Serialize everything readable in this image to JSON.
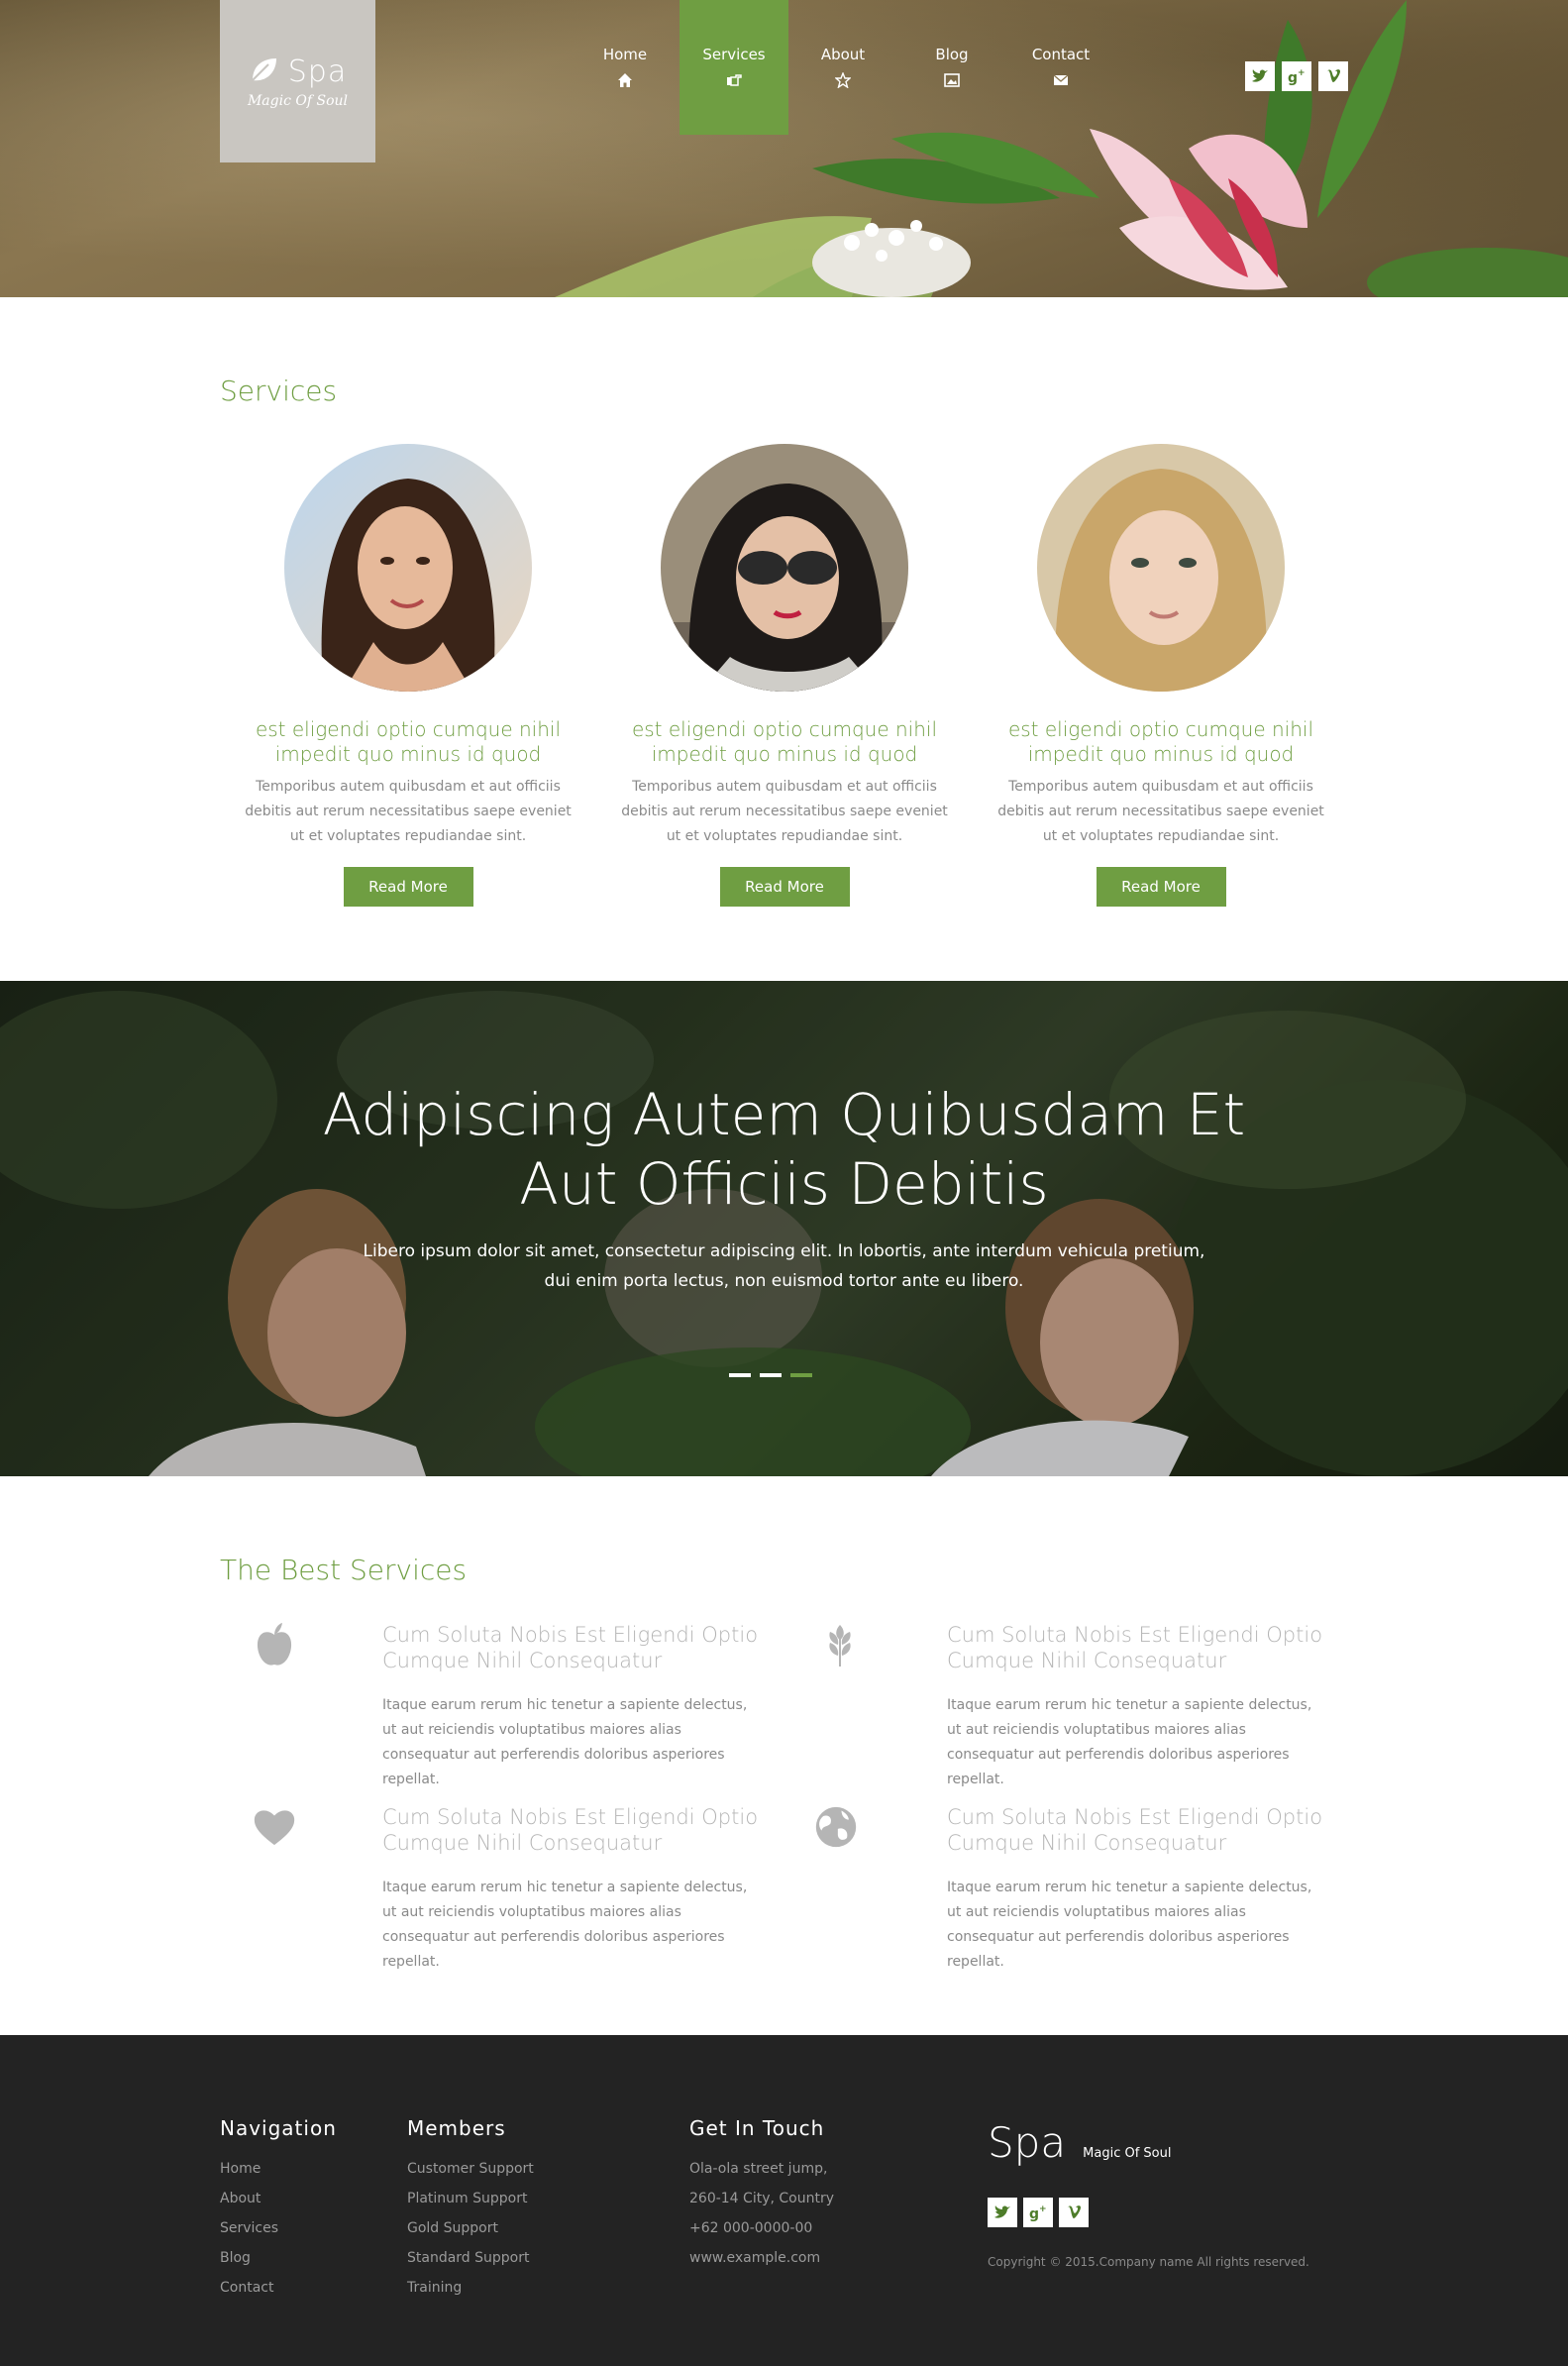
{
  "brand": {
    "name": "Spa",
    "tagline": "Magic Of Soul"
  },
  "nav": [
    {
      "label": "Home",
      "icon": "home-icon"
    },
    {
      "label": "Services",
      "icon": "hand-point-icon"
    },
    {
      "label": "About",
      "icon": "star-icon"
    },
    {
      "label": "Blog",
      "icon": "image-icon"
    },
    {
      "label": "Contact",
      "icon": "envelope-icon"
    }
  ],
  "social": [
    "twitter-icon",
    "google-plus-icon",
    "vimeo-icon"
  ],
  "services": {
    "title": "Services",
    "items": [
      {
        "heading": "est eligendi optio cumque nihil impedit quo minus id quod",
        "text": "Temporibus autem quibusdam et aut officiis debitis aut rerum necessitatibus saepe eveniet ut et voluptates repudiandae sint.",
        "button": "Read More"
      },
      {
        "heading": "est eligendi optio cumque nihil impedit quo minus id quod",
        "text": "Temporibus autem quibusdam et aut officiis debitis aut rerum necessitatibus saepe eveniet ut et voluptates repudiandae sint.",
        "button": "Read More"
      },
      {
        "heading": "est eligendi optio cumque nihil impedit quo minus id quod",
        "text": "Temporibus autem quibusdam et aut officiis debitis aut rerum necessitatibus saepe eveniet ut et voluptates repudiandae sint.",
        "button": "Read More"
      }
    ]
  },
  "banner": {
    "title_line1": "Adipiscing Autem Quibusdam Et",
    "title_line2": "Aut Officiis Debitis",
    "text_line1": "Libero ipsum dolor sit amet, consectetur adipiscing elit. In lobortis, ante interdum vehicula pretium,",
    "text_line2": "dui enim porta lectus, non euismod tortor ante eu libero."
  },
  "best": {
    "title": "The Best Services",
    "items": [
      {
        "icon": "apple-icon",
        "title": "Cum Soluta Nobis Est Eligendi Optio Cumque Nihil Consequatur",
        "text": "Itaque earum rerum hic tenetur a sapiente delectus, ut aut reiciendis voluptatibus maiores alias consequatur aut perferendis doloribus asperiores repellat."
      },
      {
        "icon": "wheat-icon",
        "title": "Cum Soluta Nobis Est Eligendi Optio Cumque Nihil Consequatur",
        "text": "Itaque earum rerum hic tenetur a sapiente delectus, ut aut reiciendis voluptatibus maiores alias consequatur aut perferendis doloribus asperiores repellat."
      },
      {
        "icon": "heart-icon",
        "title": "Cum Soluta Nobis Est Eligendi Optio Cumque Nihil Consequatur",
        "text": "Itaque earum rerum hic tenetur a sapiente delectus, ut aut reiciendis voluptatibus maiores alias consequatur aut perferendis doloribus asperiores repellat."
      },
      {
        "icon": "globe-icon",
        "title": "Cum Soluta Nobis Est Eligendi Optio Cumque Nihil Consequatur",
        "text": "Itaque earum rerum hic tenetur a sapiente delectus, ut aut reiciendis voluptatibus maiores alias consequatur aut perferendis doloribus asperiores repellat."
      }
    ]
  },
  "footer": {
    "navigation": {
      "title": "Navigation",
      "items": [
        "Home",
        "About",
        "Services",
        "Blog",
        "Contact"
      ]
    },
    "members": {
      "title": "Members",
      "items": [
        "Customer Support",
        "Platinum Support",
        "Gold Support",
        "Standard Support",
        "Training"
      ]
    },
    "contact": {
      "title": "Get In Touch",
      "items": [
        "Ola-ola street jump,",
        "260-14 City, Country",
        "+62 000-0000-00",
        "www.example.com"
      ]
    },
    "brand": "Spa",
    "tagline": "Magic Of Soul",
    "copyright": "Copyright © 2015.Company name All rights reserved."
  },
  "colors": {
    "accent": "#6f9e42",
    "footer_bg": "#232323",
    "logo_bg": "#c9c6c1"
  }
}
